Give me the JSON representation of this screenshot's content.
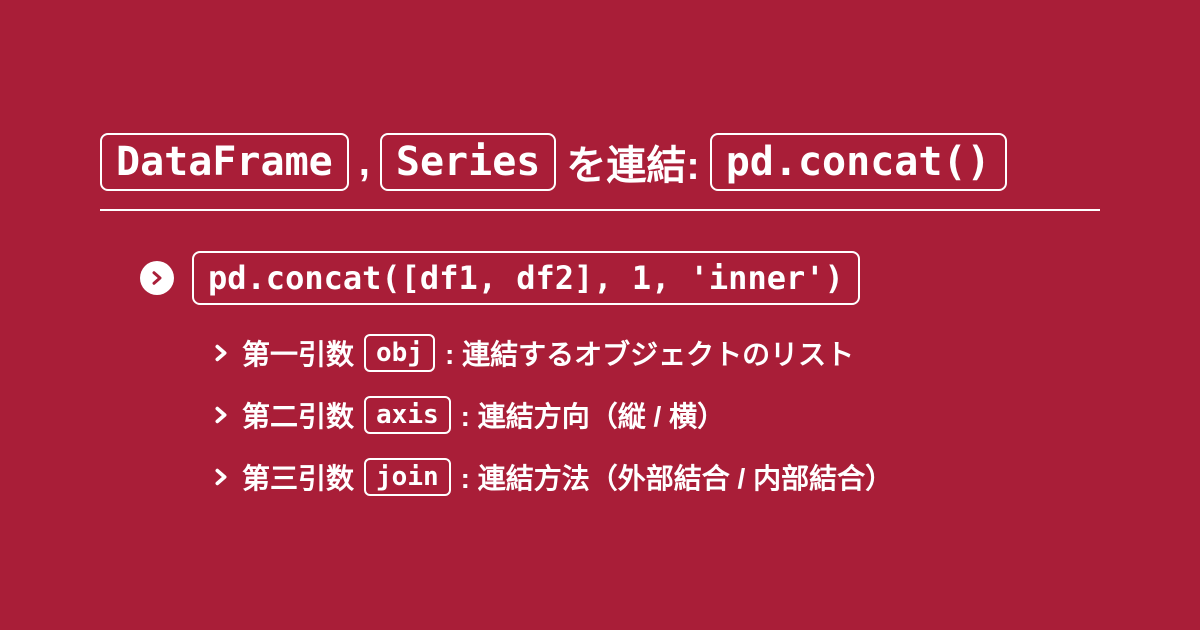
{
  "title": {
    "code1": "DataFrame",
    "comma": ",",
    "code2": "Series",
    "text": "を連結:",
    "code3": "pd.concat()"
  },
  "main_code": "pd.concat([df1, df2], 1, 'inner')",
  "params": [
    {
      "label": "第一引数",
      "code": "obj",
      "desc": ": 連結するオブジェクトのリスト"
    },
    {
      "label": "第二引数",
      "code": "axis",
      "desc": ": 連結方向（縦 / 横）"
    },
    {
      "label": "第三引数",
      "code": "join",
      "desc": ": 連結方法（外部結合 / 内部結合）"
    }
  ]
}
